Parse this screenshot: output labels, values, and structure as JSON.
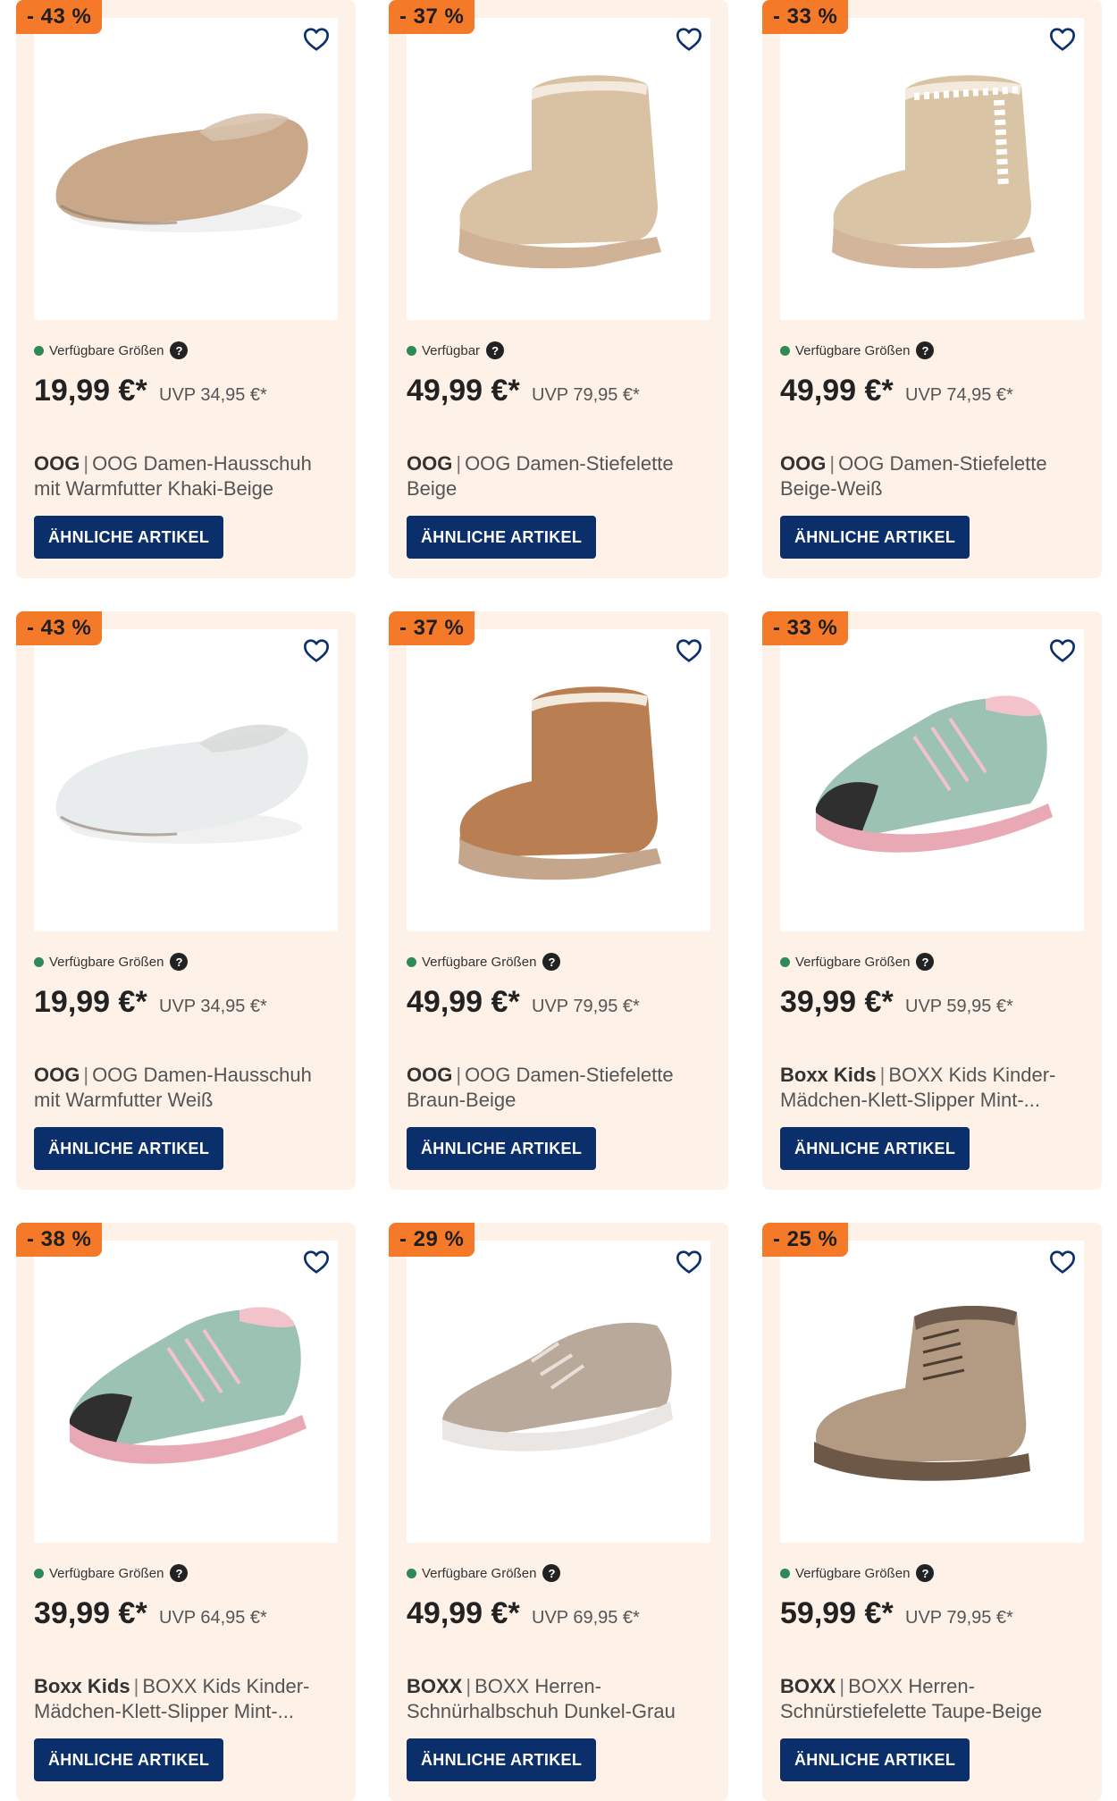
{
  "products": [
    {
      "discount": "- 43 %",
      "availability": "Verfügbare Größen",
      "price": "19,99 €*",
      "uvp": "UVP 34,95 €*",
      "brand": "OOG",
      "name": "OOG Damen-Hausschuh mit Warmfutter Khaki-Beige",
      "button": "ÄHNLICHE ARTIKEL",
      "image_icon": "slipper-khaki-beige",
      "colors": {
        "main": "#c9a88a",
        "sole": "#d7c1ab"
      }
    },
    {
      "discount": "- 37 %",
      "availability": "Verfügbar",
      "price": "49,99 €*",
      "uvp": "UVP 79,95 €*",
      "brand": "OOG",
      "name": "OOG Damen-Stiefelette Beige",
      "button": "ÄHNLICHE ARTIKEL",
      "image_icon": "ankle-boot-beige",
      "colors": {
        "main": "#d8c2a3",
        "sole": "#d0b297"
      }
    },
    {
      "discount": "- 33 %",
      "availability": "Verfügbare Größen",
      "price": "49,99 €*",
      "uvp": "UVP 74,95 €*",
      "brand": "OOG",
      "name": "OOG Damen-Stiefelette Beige-Weiß",
      "button": "ÄHNLICHE ARTIKEL",
      "image_icon": "ankle-boot-beige-white",
      "colors": {
        "main": "#d9c4a6",
        "sole": "#d3b59b"
      }
    },
    {
      "discount": "- 43 %",
      "availability": "Verfügbare Größen",
      "price": "19,99 €*",
      "uvp": "UVP 34,95 €*",
      "brand": "OOG",
      "name": "OOG Damen-Hausschuh mit Warmfutter Weiß",
      "button": "ÄHNLICHE ARTIKEL",
      "image_icon": "slipper-white",
      "colors": {
        "main": "#e9ecec",
        "sole": "#d9dcdb"
      }
    },
    {
      "discount": "- 37 %",
      "availability": "Verfügbare Größen",
      "price": "49,99 €*",
      "uvp": "UVP 79,95 €*",
      "brand": "OOG",
      "name": "OOG Damen-Stiefelette Braun-Beige",
      "button": "ÄHNLICHE ARTIKEL",
      "image_icon": "ankle-boot-brown",
      "colors": {
        "main": "#b97e52",
        "sole": "#c3a68b"
      }
    },
    {
      "discount": "- 33 %",
      "availability": "Verfügbare Größen",
      "price": "39,99 €*",
      "uvp": "UVP 59,95 €*",
      "brand": "Boxx Kids",
      "name": "BOXX Kids Kinder-Mädchen-Klett-Slipper Mint-...",
      "button": "ÄHNLICHE ARTIKEL",
      "image_icon": "kids-sneaker-mint",
      "colors": {
        "main": "#9cc2b3",
        "sole": "#e8a9b5"
      }
    },
    {
      "discount": "- 38 %",
      "availability": "Verfügbare Größen",
      "price": "39,99 €*",
      "uvp": "UVP 64,95 €*",
      "brand": "Boxx Kids",
      "name": "BOXX Kids Kinder-Mädchen-Klett-Slipper Mint-...",
      "button": "ÄHNLICHE ARTIKEL",
      "image_icon": "kids-sneaker-mint",
      "colors": {
        "main": "#9cc2b3",
        "sole": "#e8a9b5"
      }
    },
    {
      "discount": "- 29 %",
      "availability": "Verfügbare Größen",
      "price": "49,99 €*",
      "uvp": "UVP 69,95 €*",
      "brand": "BOXX",
      "name": "BOXX Herren-Schnürhalbschuh Dunkel-Grau",
      "button": "ÄHNLICHE ARTIKEL",
      "image_icon": "sneaker-taupe",
      "colors": {
        "main": "#b8a99b",
        "sole": "#e9e6e3"
      }
    },
    {
      "discount": "- 25 %",
      "availability": "Verfügbare Größen",
      "price": "59,99 €*",
      "uvp": "UVP 79,95 €*",
      "brand": "BOXX",
      "name": "BOXX Herren-Schnürstiefelette Taupe-Beige",
      "button": "ÄHNLICHE ARTIKEL",
      "image_icon": "lace-boot-taupe",
      "colors": {
        "main": "#b39a83",
        "sole": "#6d5848"
      }
    }
  ],
  "theme": {
    "card_bg": "#fdf1e8",
    "badge_bg": "#f47a2a",
    "button_bg": "#0b2f6b",
    "available_dot": "#2e8b57"
  }
}
